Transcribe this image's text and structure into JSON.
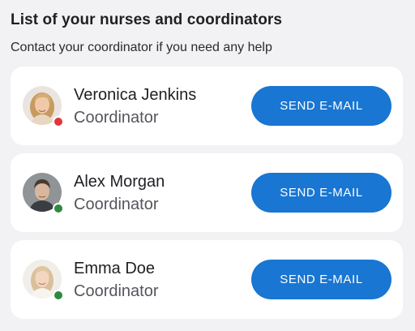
{
  "header": {
    "title": "List of your nurses and coordinators",
    "subtitle": "Contact your coordinator if you need any help"
  },
  "contacts": [
    {
      "name": "Veronica Jenkins",
      "role": "Coordinator",
      "button_label": "SEND E-MAIL",
      "status_color": "#e0353b",
      "avatar": "woman-blonde-portrait"
    },
    {
      "name": "Alex Morgan",
      "role": "Coordinator",
      "button_label": "SEND E-MAIL",
      "status_color": "#2e8b3e",
      "avatar": "man-dark-hair-portrait"
    },
    {
      "name": "Emma Doe",
      "role": "Coordinator",
      "button_label": "SEND E-MAIL",
      "status_color": "#2e8b3e",
      "avatar": "woman-light-hair-portrait"
    }
  ],
  "colors": {
    "accent": "#1976d2",
    "background": "#f2f2f4",
    "card": "#ffffff"
  }
}
